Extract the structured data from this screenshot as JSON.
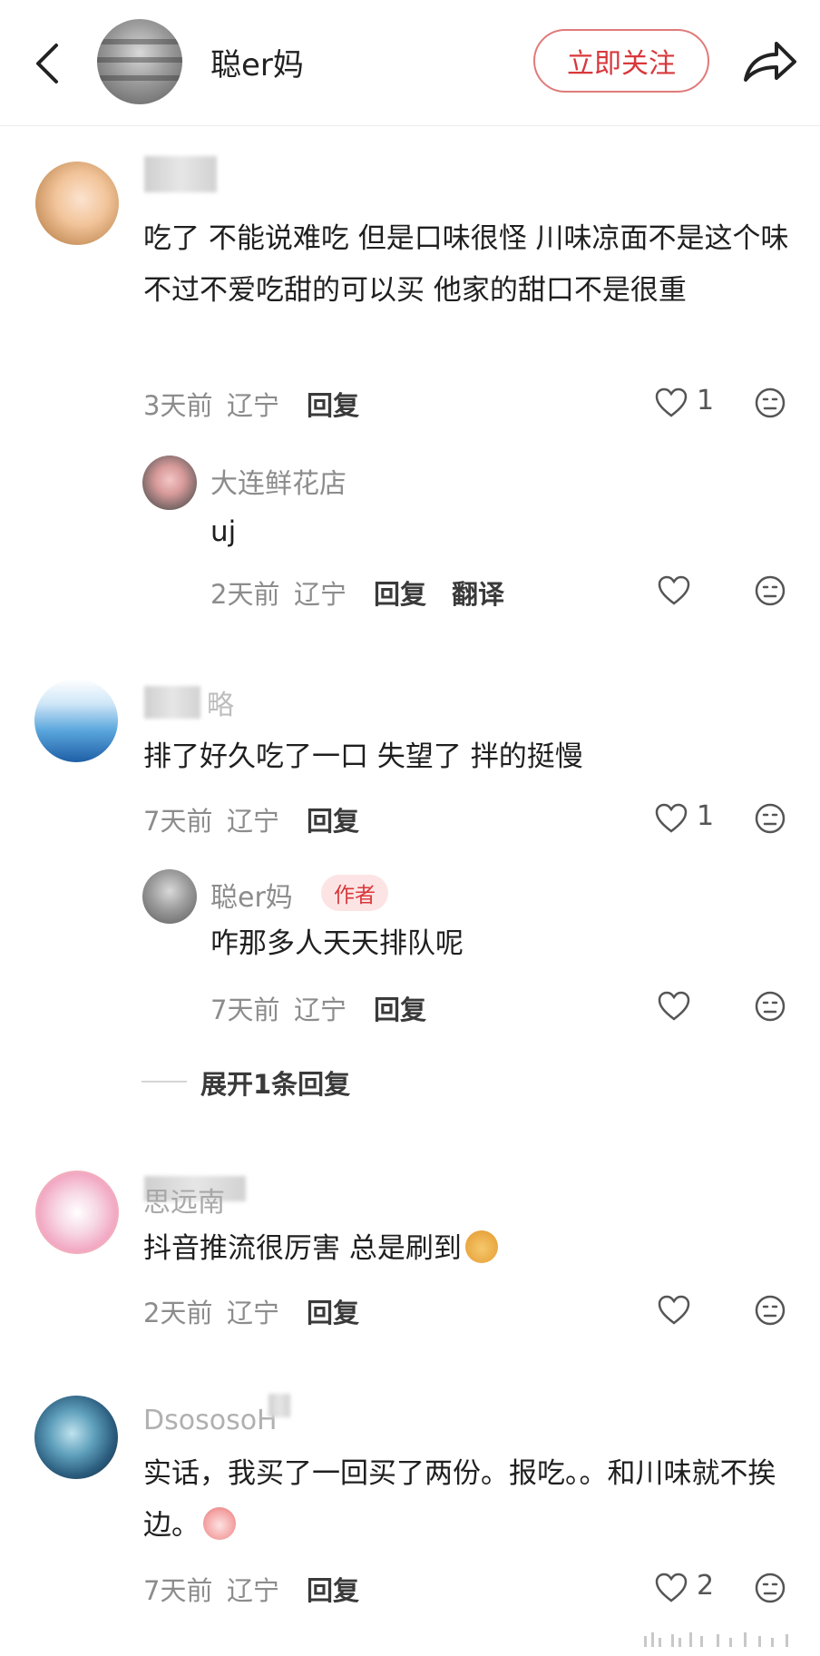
{
  "header": {
    "user_name": "聪er妈",
    "follow_label": "立即关注"
  },
  "comments": [
    {
      "name": "",
      "text": "吃了 不能说难吃 但是口味很怪 川味凉面不是这个味 不过不爱吃甜的可以买 他家的甜口不是很重",
      "time": "3天前",
      "location": "辽宁",
      "reply_label": "回复",
      "likes": "1"
    },
    {
      "name": "大连鲜花店",
      "text": "uj",
      "time": "2天前",
      "location": "辽宁",
      "reply_label": "回复",
      "translate_label": "翻译",
      "likes": ""
    },
    {
      "name": "略",
      "text": "排了好久吃了一口 失望了 拌的挺慢",
      "time": "7天前",
      "location": "辽宁",
      "reply_label": "回复",
      "likes": "1"
    },
    {
      "name": "聪er妈",
      "author_tag": "作者",
      "text": "咋那多人天天排队呢",
      "time": "7天前",
      "location": "辽宁",
      "reply_label": "回复",
      "likes": ""
    },
    {
      "name": "思远南",
      "text": "抖音推流很厉害 总是刷到",
      "time": "2天前",
      "location": "辽宁",
      "reply_label": "回复",
      "likes": ""
    },
    {
      "name": "DsososoH",
      "text": "实话，我买了一回买了两份。报吃。。和川味就不挨边。",
      "time": "7天前",
      "location": "辽宁",
      "reply_label": "回复",
      "likes": "2"
    }
  ],
  "expand_label": "展开1条回复",
  "icons": {
    "back": "back-arrow-icon",
    "share": "share-icon",
    "like": "heart-icon",
    "dislike": "dislike-face-icon"
  },
  "colors": {
    "accent": "#d8383b",
    "muted": "#8c8c8c"
  }
}
